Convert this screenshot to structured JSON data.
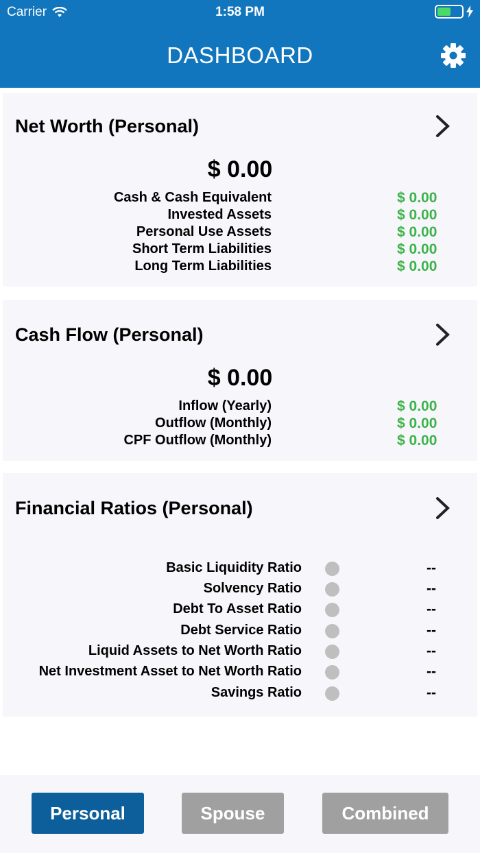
{
  "status_bar": {
    "carrier": "Carrier",
    "time": "1:58 PM"
  },
  "header": {
    "title": "DASHBOARD",
    "settings_icon": "gear-icon"
  },
  "net_worth": {
    "title": "Net Worth (Personal)",
    "total": "$ 0.00",
    "rows": [
      {
        "label": "Cash & Cash Equivalent",
        "value": "$ 0.00"
      },
      {
        "label": "Invested Assets",
        "value": "$ 0.00"
      },
      {
        "label": "Personal Use Assets",
        "value": "$ 0.00"
      },
      {
        "label": "Short Term Liabilities",
        "value": "$ 0.00"
      },
      {
        "label": "Long Term Liabilities",
        "value": "$ 0.00"
      }
    ]
  },
  "cash_flow": {
    "title": "Cash Flow (Personal)",
    "total": "$ 0.00",
    "rows": [
      {
        "label": "Inflow (Yearly)",
        "value": "$ 0.00"
      },
      {
        "label": "Outflow (Monthly)",
        "value": "$ 0.00"
      },
      {
        "label": "CPF Outflow (Monthly)",
        "value": "$ 0.00"
      }
    ]
  },
  "ratios": {
    "title": "Financial Ratios (Personal)",
    "rows": [
      {
        "label": "Basic Liquidity Ratio",
        "value": "--"
      },
      {
        "label": "Solvency Ratio",
        "value": "--"
      },
      {
        "label": "Debt To Asset Ratio",
        "value": "--"
      },
      {
        "label": "Debt Service Ratio",
        "value": "--"
      },
      {
        "label": "Liquid Assets to Net Worth Ratio",
        "value": "--"
      },
      {
        "label": "Net Investment Asset to Net Worth Ratio",
        "value": "--"
      },
      {
        "label": "Savings Ratio",
        "value": "--"
      }
    ]
  },
  "tabs": [
    {
      "label": "Personal",
      "active": true
    },
    {
      "label": "Spouse",
      "active": false
    },
    {
      "label": "Combined",
      "active": false
    }
  ],
  "colors": {
    "header": "#1176bd",
    "positive": "#3cb34a",
    "tab_active": "#0d5f9c",
    "tab_inactive": "#a0a0a0",
    "status_dot": "#bfbfbf"
  }
}
